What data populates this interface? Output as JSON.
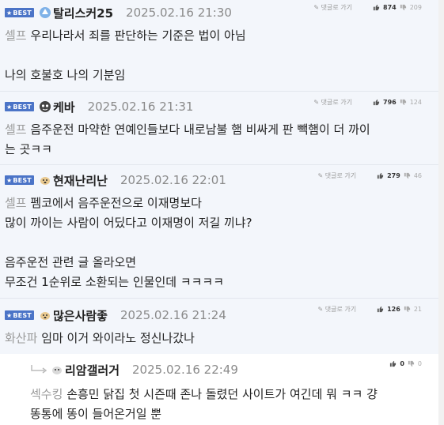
{
  "badge_label": "BEST",
  "reply_label": "댓글로 가기",
  "comments": [
    {
      "nick": "탈리스커25",
      "date": "2025.02.16 21:30",
      "upvotes": "874",
      "downvotes": "209",
      "prefix": "셀프",
      "lines": [
        "우리나라서 죄를 판단하는 기준은 법이 아님",
        "",
        "나의 호불호 나의 기분임"
      ]
    },
    {
      "nick": "케바",
      "date": "2025.02.16 21:31",
      "upvotes": "796",
      "downvotes": "124",
      "prefix": "셀프",
      "lines": [
        "음주운전 마약한 연예인들보다 내로남불 햄 비싸게 판 빽햄이 더 까이",
        "는 곳ㅋㅋ"
      ]
    },
    {
      "nick": "현재난리난",
      "date": "2025.02.16 22:01",
      "upvotes": "279",
      "downvotes": "46",
      "prefix": "셀프",
      "lines": [
        "펨코에서 음주운전으로 이재명보다",
        "많이 까이는 사람이 어딨다고 이재명이 저길 끼냐?",
        "",
        "음주운전 관련 글 올라오면",
        "무조건 1순위로 소환되는 인물인데 ㅋㅋㅋㅋ"
      ]
    },
    {
      "nick": "많은사람좋",
      "date": "2025.02.16 21:24",
      "upvotes": "126",
      "downvotes": "21",
      "prefix": "화산파",
      "lines": [
        "임마 이거 와이라노 정신나갔나"
      ]
    },
    {
      "nick": "리암갤러거",
      "date": "2025.02.16 22:49",
      "upvotes": "0",
      "downvotes": "0",
      "prefix": "섹수킹",
      "lines": [
        "손흥민 닭집 첫 시즌때 존나 돌렸던 사이트가 여긴데 뭐 ㅋㅋ 걍",
        "똥통에 똥이 들어온거일 뿐"
      ]
    }
  ]
}
